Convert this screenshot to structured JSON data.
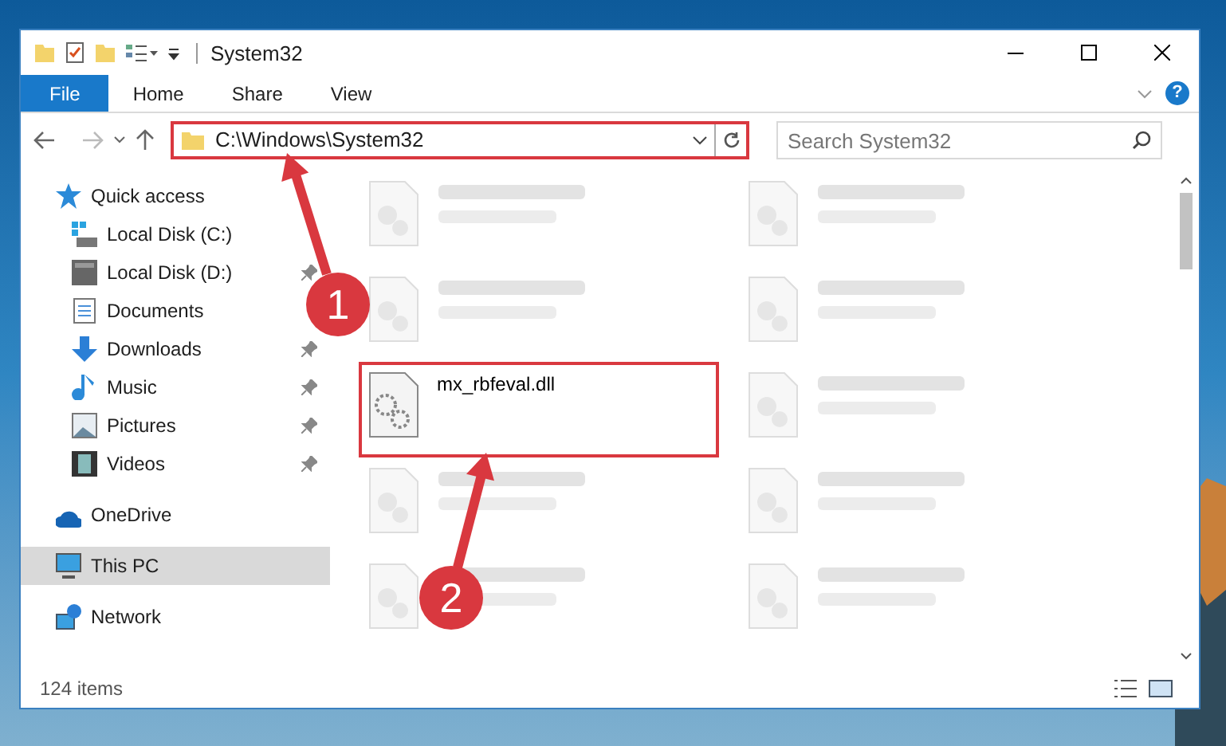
{
  "window": {
    "title": "System32"
  },
  "ribbon_tabs": [
    {
      "label": "File",
      "selected": true
    },
    {
      "label": "Home",
      "selected": false
    },
    {
      "label": "Share",
      "selected": false
    },
    {
      "label": "View",
      "selected": false
    }
  ],
  "help_button": {
    "label": "?"
  },
  "address": {
    "value": "C:\\Windows\\System32",
    "highlighted": true
  },
  "search": {
    "placeholder": "Search System32"
  },
  "navigation": [
    {
      "label": "Quick access",
      "selected": false,
      "children": [
        {
          "label": "Local Disk (C:)",
          "pinned": false
        },
        {
          "label": "Local Disk (D:)",
          "pinned": true
        },
        {
          "label": "Documents",
          "pinned": false
        },
        {
          "label": "Downloads",
          "pinned": true
        },
        {
          "label": "Music",
          "pinned": true
        },
        {
          "label": "Pictures",
          "pinned": true
        },
        {
          "label": "Videos",
          "pinned": true
        }
      ]
    },
    {
      "label": "OneDrive",
      "selected": false
    },
    {
      "label": "This PC",
      "selected": true
    },
    {
      "label": "Network",
      "selected": false
    }
  ],
  "files": [
    {
      "kind": "blurred",
      "highlighted": false
    },
    {
      "kind": "blurred",
      "highlighted": false
    },
    {
      "kind": "blurred",
      "highlighted": false
    },
    {
      "kind": "blurred",
      "highlighted": false
    },
    {
      "kind": "file",
      "name": "mx_rbfeval.dll",
      "highlighted": true
    },
    {
      "kind": "blurred",
      "highlighted": false
    },
    {
      "kind": "blurred",
      "highlighted": false
    },
    {
      "kind": "blurred",
      "highlighted": false
    },
    {
      "kind": "blurred",
      "highlighted": false
    },
    {
      "kind": "blurred",
      "highlighted": false
    }
  ],
  "status_bar": {
    "item_count": "124 items"
  },
  "callouts": [
    {
      "number": "1"
    },
    {
      "number": "2"
    }
  ]
}
